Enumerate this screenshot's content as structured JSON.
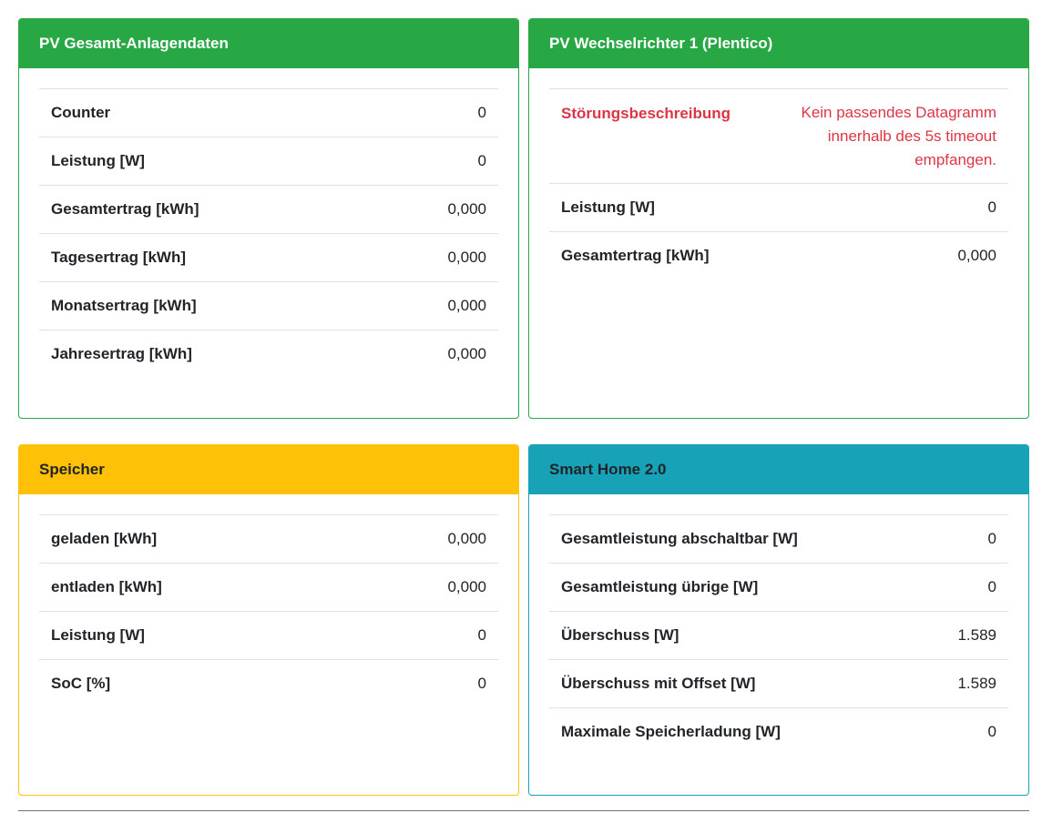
{
  "pv_total": {
    "title": "PV Gesamt-Anlagendaten",
    "rows": [
      {
        "label": "Counter",
        "value": "0"
      },
      {
        "label": "Leistung [W]",
        "value": "0"
      },
      {
        "label": "Gesamtertrag [kWh]",
        "value": "0,000"
      },
      {
        "label": "Tagesertrag [kWh]",
        "value": "0,000"
      },
      {
        "label": "Monatsertrag [kWh]",
        "value": "0,000"
      },
      {
        "label": "Jahresertrag [kWh]",
        "value": "0,000"
      }
    ],
    "color": "#28a745"
  },
  "inverter": {
    "title": "PV Wechselrichter 1 (Plentico)",
    "fault": {
      "label": "Störungsbeschreibung",
      "value": "Kein passendes Datagramm innerhalb des 5s timeout empfangen.",
      "color": "#dc3545"
    },
    "rows": [
      {
        "label": "Leistung [W]",
        "value": "0"
      },
      {
        "label": "Gesamtertrag [kWh]",
        "value": "0,000"
      }
    ],
    "color": "#28a745"
  },
  "storage": {
    "title": "Speicher",
    "rows": [
      {
        "label": "geladen [kWh]",
        "value": "0,000"
      },
      {
        "label": "entladen [kWh]",
        "value": "0,000"
      },
      {
        "label": "Leistung [W]",
        "value": "0"
      },
      {
        "label": "SoC [%]",
        "value": "0"
      }
    ],
    "color": "#ffc107"
  },
  "smarthome": {
    "title": "Smart Home 2.0",
    "rows": [
      {
        "label": "Gesamtleistung abschaltbar [W]",
        "value": "0"
      },
      {
        "label": "Gesamtleistung übrige [W]",
        "value": "0"
      },
      {
        "label": "Überschuss [W]",
        "value": "1.589"
      },
      {
        "label": "Überschuss mit Offset [W]",
        "value": "1.589"
      },
      {
        "label": "Maximale Speicherladung [W]",
        "value": "0"
      }
    ],
    "color": "#17a2b8"
  }
}
